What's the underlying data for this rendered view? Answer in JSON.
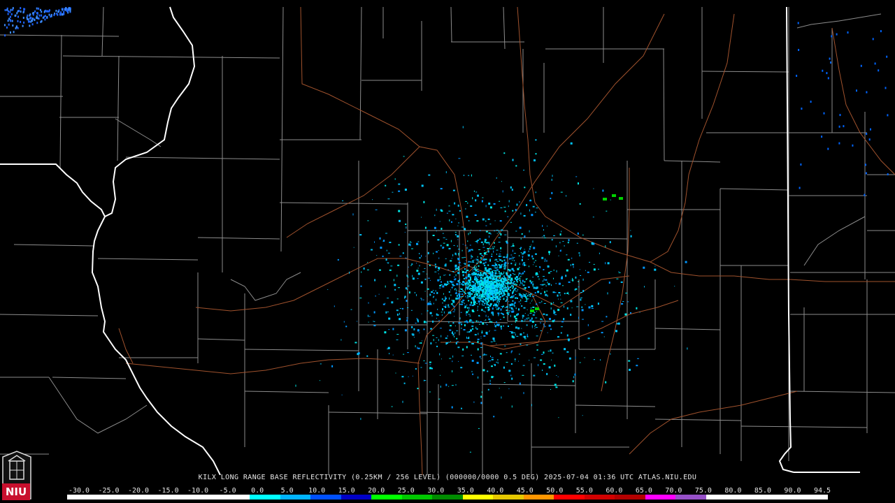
{
  "radar": {
    "caption": "KILX LONG RANGE BASE REFLECTIVITY (0.25KM / 256 LEVEL) (000000/0000 0.5 DEG) 2025-07-04 01:36 UTC  ATLAS.NIU.EDU",
    "logo_text": "NIU"
  },
  "scale": {
    "labels": [
      "-30.0",
      "-25.0",
      "-20.0",
      "-15.0",
      "-10.0",
      "-5.0",
      "0.0",
      "5.0",
      "10.0",
      "15.0",
      "20.0",
      "25.0",
      "30.0",
      "35.0",
      "40.0",
      "45.0",
      "50.0",
      "55.0",
      "60.0",
      "65.0",
      "70.0",
      "75.0",
      "80.0",
      "85.0",
      "90.0",
      "94.5"
    ],
    "colors": [
      "#ffffff",
      "#ffffff",
      "#ffffff",
      "#ffffff",
      "#ffffff",
      "#ffffff",
      "#00ffff",
      "#00b4ff",
      "#0050ff",
      "#0000c8",
      "#00ff00",
      "#00c800",
      "#008c00",
      "#ffff00",
      "#e6c800",
      "#ff9600",
      "#ff0000",
      "#d20000",
      "#b40000",
      "#ff00ff",
      "#9650c8",
      "#ffffff",
      "#ffffff",
      "#ffffff",
      "#ffffff"
    ]
  },
  "colors": {
    "county_border": "#8c8c8c",
    "state_border": "#ffffff",
    "highway": "#a0522d",
    "echo_primary": "#00c8ff",
    "echo_secondary": "#00e6e6",
    "echo_strong": "#00d200"
  }
}
